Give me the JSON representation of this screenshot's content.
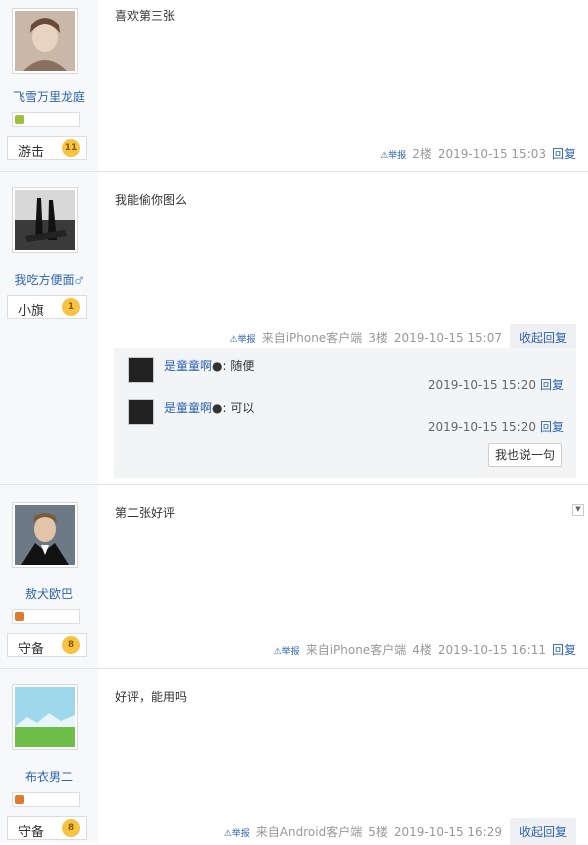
{
  "posts": [
    {
      "username": "飞雪万里龙庭",
      "rank_name": "游击",
      "rank_level": "11",
      "content": "喜欢第三张",
      "report_label": "⚠举报",
      "source": "",
      "floor": "2楼",
      "time": "2019-10-15 15:03",
      "reply_label": "回复"
    },
    {
      "username": "我吃方便面",
      "rank_name": "小旗",
      "rank_level": "1",
      "content": "我能偷你图么",
      "report_label": "⚠举报",
      "source": "来自iPhone客户端",
      "floor": "3楼",
      "time": "2019-10-15 15:07",
      "reply_label": "收起回复",
      "sub_replies": [
        {
          "user": "是童童啊",
          "text": ": 随便",
          "time": "2019-10-15 15:20",
          "reply_label": "回复"
        },
        {
          "user": "是童童啊",
          "text": ": 可以",
          "time": "2019-10-15 15:20",
          "reply_label": "回复"
        }
      ],
      "say_button": "我也说一句"
    },
    {
      "username": "敖犬欧巴",
      "rank_name": "守备",
      "rank_level": "8",
      "content": "第二张好评",
      "report_label": "⚠举报",
      "source": "来自iPhone客户端",
      "floor": "4楼",
      "time": "2019-10-15 16:11",
      "reply_label": "回复"
    },
    {
      "username": "布衣男二",
      "rank_name": "守备",
      "rank_level": "8",
      "content": "好评，能用吗",
      "report_label": "⚠举报",
      "source": "来自Android客户端",
      "floor": "5楼",
      "time": "2019-10-15 16:29",
      "reply_label": "收起回复"
    }
  ],
  "colors": {
    "link": "#2d64b3",
    "sidebar_bg": "#f7f8fa",
    "badge": "#f6c343"
  }
}
